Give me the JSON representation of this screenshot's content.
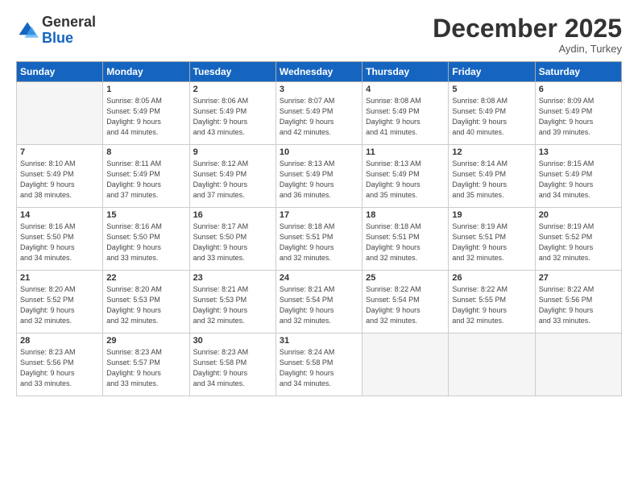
{
  "header": {
    "logo_line1": "General",
    "logo_line2": "Blue",
    "month_title": "December 2025",
    "location": "Aydin, Turkey"
  },
  "days_of_week": [
    "Sunday",
    "Monday",
    "Tuesday",
    "Wednesday",
    "Thursday",
    "Friday",
    "Saturday"
  ],
  "weeks": [
    [
      {
        "num": "",
        "info": ""
      },
      {
        "num": "1",
        "info": "Sunrise: 8:05 AM\nSunset: 5:49 PM\nDaylight: 9 hours\nand 44 minutes."
      },
      {
        "num": "2",
        "info": "Sunrise: 8:06 AM\nSunset: 5:49 PM\nDaylight: 9 hours\nand 43 minutes."
      },
      {
        "num": "3",
        "info": "Sunrise: 8:07 AM\nSunset: 5:49 PM\nDaylight: 9 hours\nand 42 minutes."
      },
      {
        "num": "4",
        "info": "Sunrise: 8:08 AM\nSunset: 5:49 PM\nDaylight: 9 hours\nand 41 minutes."
      },
      {
        "num": "5",
        "info": "Sunrise: 8:08 AM\nSunset: 5:49 PM\nDaylight: 9 hours\nand 40 minutes."
      },
      {
        "num": "6",
        "info": "Sunrise: 8:09 AM\nSunset: 5:49 PM\nDaylight: 9 hours\nand 39 minutes."
      }
    ],
    [
      {
        "num": "7",
        "info": "Sunrise: 8:10 AM\nSunset: 5:49 PM\nDaylight: 9 hours\nand 38 minutes."
      },
      {
        "num": "8",
        "info": "Sunrise: 8:11 AM\nSunset: 5:49 PM\nDaylight: 9 hours\nand 37 minutes."
      },
      {
        "num": "9",
        "info": "Sunrise: 8:12 AM\nSunset: 5:49 PM\nDaylight: 9 hours\nand 37 minutes."
      },
      {
        "num": "10",
        "info": "Sunrise: 8:13 AM\nSunset: 5:49 PM\nDaylight: 9 hours\nand 36 minutes."
      },
      {
        "num": "11",
        "info": "Sunrise: 8:13 AM\nSunset: 5:49 PM\nDaylight: 9 hours\nand 35 minutes."
      },
      {
        "num": "12",
        "info": "Sunrise: 8:14 AM\nSunset: 5:49 PM\nDaylight: 9 hours\nand 35 minutes."
      },
      {
        "num": "13",
        "info": "Sunrise: 8:15 AM\nSunset: 5:49 PM\nDaylight: 9 hours\nand 34 minutes."
      }
    ],
    [
      {
        "num": "14",
        "info": "Sunrise: 8:16 AM\nSunset: 5:50 PM\nDaylight: 9 hours\nand 34 minutes."
      },
      {
        "num": "15",
        "info": "Sunrise: 8:16 AM\nSunset: 5:50 PM\nDaylight: 9 hours\nand 33 minutes."
      },
      {
        "num": "16",
        "info": "Sunrise: 8:17 AM\nSunset: 5:50 PM\nDaylight: 9 hours\nand 33 minutes."
      },
      {
        "num": "17",
        "info": "Sunrise: 8:18 AM\nSunset: 5:51 PM\nDaylight: 9 hours\nand 32 minutes."
      },
      {
        "num": "18",
        "info": "Sunrise: 8:18 AM\nSunset: 5:51 PM\nDaylight: 9 hours\nand 32 minutes."
      },
      {
        "num": "19",
        "info": "Sunrise: 8:19 AM\nSunset: 5:51 PM\nDaylight: 9 hours\nand 32 minutes."
      },
      {
        "num": "20",
        "info": "Sunrise: 8:19 AM\nSunset: 5:52 PM\nDaylight: 9 hours\nand 32 minutes."
      }
    ],
    [
      {
        "num": "21",
        "info": "Sunrise: 8:20 AM\nSunset: 5:52 PM\nDaylight: 9 hours\nand 32 minutes."
      },
      {
        "num": "22",
        "info": "Sunrise: 8:20 AM\nSunset: 5:53 PM\nDaylight: 9 hours\nand 32 minutes."
      },
      {
        "num": "23",
        "info": "Sunrise: 8:21 AM\nSunset: 5:53 PM\nDaylight: 9 hours\nand 32 minutes."
      },
      {
        "num": "24",
        "info": "Sunrise: 8:21 AM\nSunset: 5:54 PM\nDaylight: 9 hours\nand 32 minutes."
      },
      {
        "num": "25",
        "info": "Sunrise: 8:22 AM\nSunset: 5:54 PM\nDaylight: 9 hours\nand 32 minutes."
      },
      {
        "num": "26",
        "info": "Sunrise: 8:22 AM\nSunset: 5:55 PM\nDaylight: 9 hours\nand 32 minutes."
      },
      {
        "num": "27",
        "info": "Sunrise: 8:22 AM\nSunset: 5:56 PM\nDaylight: 9 hours\nand 33 minutes."
      }
    ],
    [
      {
        "num": "28",
        "info": "Sunrise: 8:23 AM\nSunset: 5:56 PM\nDaylight: 9 hours\nand 33 minutes."
      },
      {
        "num": "29",
        "info": "Sunrise: 8:23 AM\nSunset: 5:57 PM\nDaylight: 9 hours\nand 33 minutes."
      },
      {
        "num": "30",
        "info": "Sunrise: 8:23 AM\nSunset: 5:58 PM\nDaylight: 9 hours\nand 34 minutes."
      },
      {
        "num": "31",
        "info": "Sunrise: 8:24 AM\nSunset: 5:58 PM\nDaylight: 9 hours\nand 34 minutes."
      },
      {
        "num": "",
        "info": ""
      },
      {
        "num": "",
        "info": ""
      },
      {
        "num": "",
        "info": ""
      }
    ]
  ]
}
